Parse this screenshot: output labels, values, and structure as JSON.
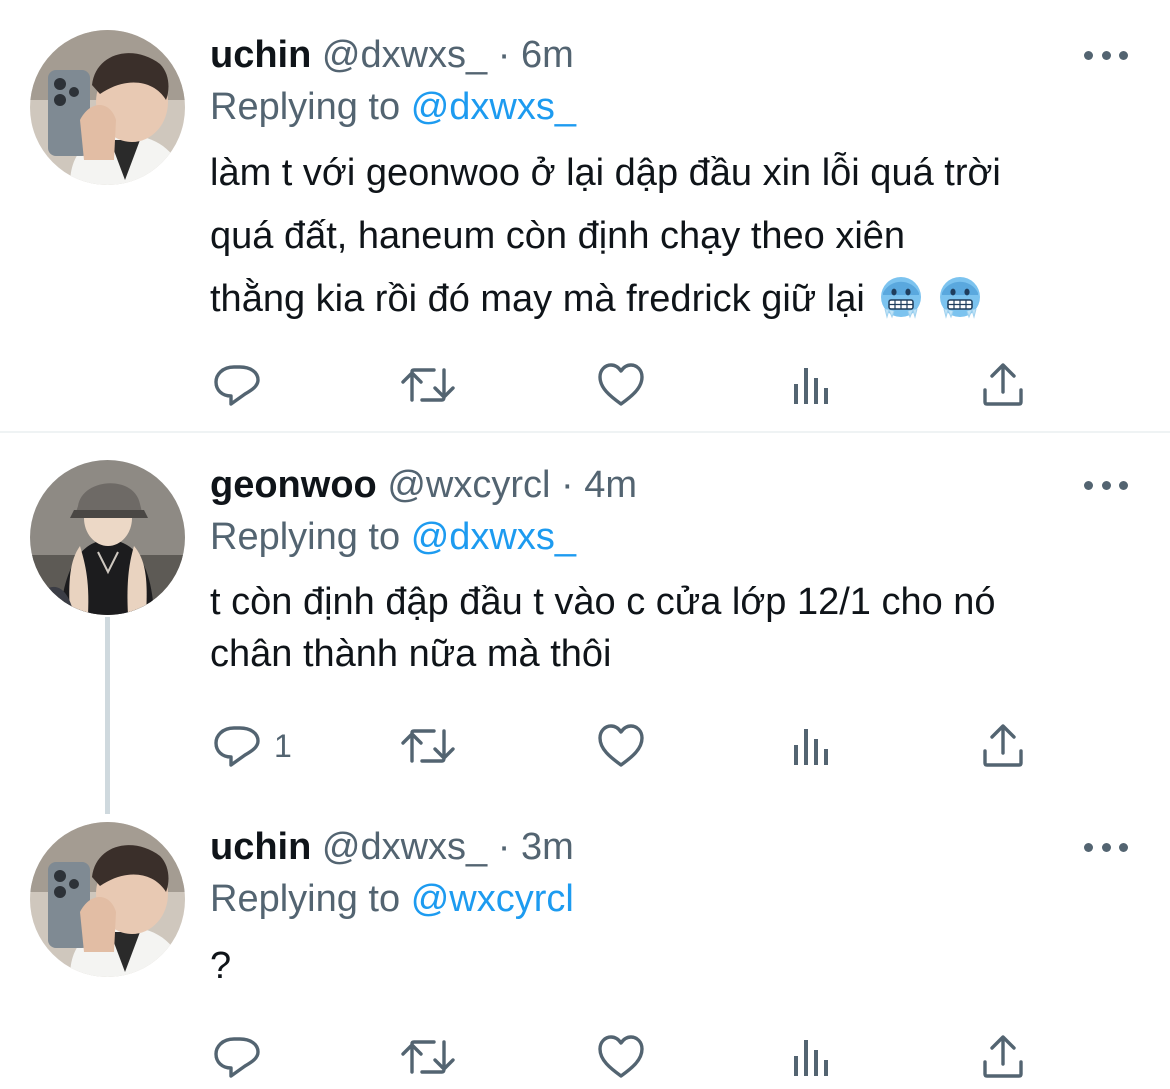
{
  "tweets": [
    {
      "name": "uchin",
      "handle": "@dxwxs_",
      "dot": "·",
      "time": "6m",
      "replying_prefix": "Replying to",
      "replying_to": "@dxwxs_",
      "lines": [
        "làm t với geonwoo ở lại dập đầu xin lỗi quá trời",
        "quá đất, haneum còn định chạy theo xiên",
        "thằng kia rồi đó may mà fredrick giữ lại"
      ],
      "emoji": [
        "cold-face-icon",
        "cold-face-icon"
      ],
      "reply_count": ""
    },
    {
      "name": "geonwoo",
      "handle": "@wxcyrcl",
      "dot": "·",
      "time": "4m",
      "replying_prefix": "Replying to",
      "replying_to": "@dxwxs_",
      "lines": [
        "t còn định đập đầu t vào c cửa lớp 12/1 cho nó",
        "chân thành nữa mà thôi"
      ],
      "reply_count": "1"
    },
    {
      "name": "uchin",
      "handle": "@dxwxs_",
      "dot": "·",
      "time": "3m",
      "replying_prefix": "Replying to",
      "replying_to": "@wxcyrcl",
      "lines": [
        "?"
      ],
      "reply_count": ""
    }
  ],
  "action_icons": [
    "reply-icon",
    "retweet-icon",
    "like-icon",
    "views-icon",
    "share-icon"
  ],
  "colors": {
    "text": "#0f1419",
    "muted": "#536471",
    "link": "#1d9bf0",
    "divider": "#eff3f4",
    "thread_line": "#cfd9de"
  }
}
